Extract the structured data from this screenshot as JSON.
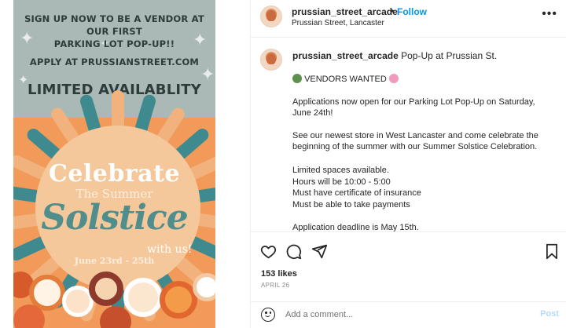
{
  "poster": {
    "line1": "SIGN UP NOW TO BE A VENDOR AT OUR FIRST",
    "line2": "PARKING LOT POP-UP!!",
    "line3": "APPLY AT PRUSSIANSTREET.COM",
    "line4": "LIMITED AVAILABLITY",
    "celebrate": "Celebrate",
    "the_summer": "The Summer",
    "solstice": "Solstice",
    "with_us": "with us!",
    "dates": "June 23rd - 25th"
  },
  "header": {
    "username": "prussian_street_arcade",
    "dot": "•",
    "follow_label": "Follow",
    "location": "Prussian Street, Lancaster",
    "more_icon": "more-horizontal-icon"
  },
  "caption": {
    "username": "prussian_street_arcade",
    "first_line": "Pop-Up at Prussian St.",
    "vendors_wanted": "VENDORS WANTED",
    "lines": [
      "Applications now open for our Parking Lot Pop-Up on Saturday,",
      "June 24th!",
      "See our newest store in West Lancaster and come celebrate the",
      "beginning of the summer with our Summer Solstice Celebration.",
      "Limited spaces available.",
      "Hours will be 10:00 - 5:00",
      "Must have certificate of insurance",
      "Must be able to take payments",
      "Application deadline is May 15th."
    ]
  },
  "engagement": {
    "likes": "153 likes",
    "date": "APRIL 26",
    "icons": [
      "heart-icon",
      "comment-icon",
      "share-icon",
      "bookmark-icon"
    ]
  },
  "comment": {
    "placeholder": "Add a comment...",
    "post_label": "Post"
  },
  "colors": {
    "follow_blue": "#0095f6",
    "post_disabled": "#b3dbff",
    "poster_gray": "#aab9b5",
    "poster_orange": "#f29a5a",
    "poster_teal": "#3f8a8f"
  }
}
